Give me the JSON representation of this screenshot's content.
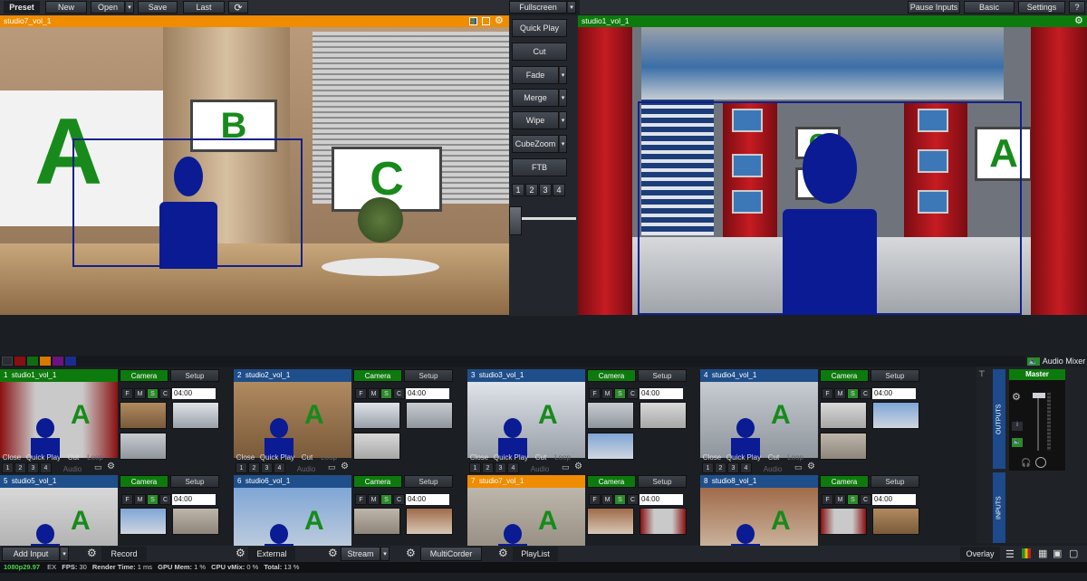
{
  "toolbar": {
    "preset": "Preset",
    "new": "New",
    "open": "Open",
    "save": "Save",
    "last": "Last",
    "fullscreen": "Fullscreen",
    "pause_inputs": "Pause Inputs",
    "basic": "Basic",
    "settings": "Settings",
    "help": "?"
  },
  "preview": {
    "title": "studio7_vol_1",
    "color": "#f08c00"
  },
  "output": {
    "title": "studio1_vol_1",
    "color": "#0d7a0d"
  },
  "transitions": {
    "quick_play": "Quick Play",
    "cut": "Cut",
    "fade": "Fade",
    "merge": "Merge",
    "wipe": "Wipe",
    "cubezoom": "CubeZoom",
    "ftb": "FTB",
    "pages": [
      "1",
      "2",
      "3",
      "4"
    ]
  },
  "letters": {
    "a": "A",
    "b": "B",
    "c": "C"
  },
  "colors": [
    "#8a0f0f",
    "#0f6e10",
    "#d67a00",
    "#6b1480",
    "#1c2c8e"
  ],
  "audio_mixer": "Audio Mixer",
  "master": "Master",
  "outputs_label": "OUTPUTS",
  "inputs_label": "INPUTS",
  "input_common": {
    "camera": "Camera",
    "setup": "Setup",
    "time": "04:00",
    "close": "Close",
    "quick_play": "Quick Play",
    "cut": "Cut",
    "loop": "Loop",
    "audio": "Audio",
    "f": "F",
    "m": "M",
    "s": "S",
    "c": "C",
    "nums": [
      "1",
      "2",
      "3",
      "4"
    ]
  },
  "inputs": [
    {
      "num": "1",
      "name": "studio1_vol_1",
      "color": "#0d7a0d"
    },
    {
      "num": "2",
      "name": "studio2_vol_1",
      "color": "#1f4f8a"
    },
    {
      "num": "3",
      "name": "studio3_vol_1",
      "color": "#1f4f8a"
    },
    {
      "num": "4",
      "name": "studio4_vol_1",
      "color": "#1f4f8a"
    },
    {
      "num": "5",
      "name": "studio5_vol_1",
      "color": "#1f4f8a"
    },
    {
      "num": "6",
      "name": "studio6_vol_1",
      "color": "#1f4f8a"
    },
    {
      "num": "7",
      "name": "studio7_vol_1",
      "color": "#f08c00"
    },
    {
      "num": "8",
      "name": "studio8_vol_1",
      "color": "#1f4f8a"
    }
  ],
  "bottom": {
    "add_input": "Add Input",
    "record": "Record",
    "external": "External",
    "stream": "Stream",
    "multicorder": "MultiCorder",
    "playlist": "PlayList",
    "overlay": "Overlay"
  },
  "status": {
    "format": "1080p29.97",
    "ex": "EX",
    "fps_label": "FPS:",
    "fps": "30",
    "render_label": "Render Time:",
    "render": "1 ms",
    "gpu_label": "GPU Mem:",
    "gpu": "1 %",
    "cpu_label": "CPU vMix:",
    "cpu": "0 %",
    "total_label": "Total:",
    "total": "13 %"
  }
}
